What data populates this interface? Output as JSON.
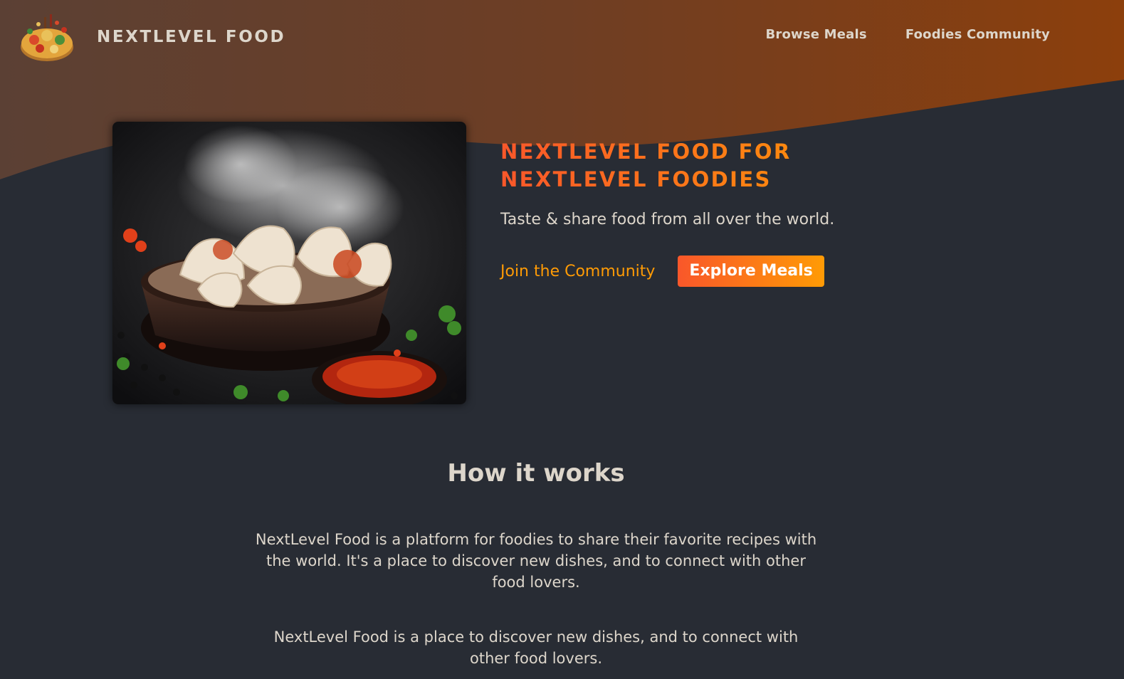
{
  "header": {
    "logo_text": "NEXTLEVEL FOOD",
    "logo_icon": "food-plate-logo"
  },
  "nav": {
    "items": [
      {
        "label": "Browse Meals"
      },
      {
        "label": "Foodies Community"
      }
    ]
  },
  "hero": {
    "image_icon": "dumplings-photo",
    "title": "NEXTLEVEL FOOD FOR NEXTLEVEL FOODIES",
    "subtitle": "Taste & share food from all over the world.",
    "join_link": "Join the Community",
    "explore_button": "Explore Meals"
  },
  "how_it_works": {
    "heading": "How it works",
    "paragraph1": "NextLevel Food is a platform for foodies to share their favorite recipes with the world. It's a place to discover new dishes, and to connect with other food lovers.",
    "paragraph2": "NextLevel Food is a place to discover new dishes, and to connect with other food lovers."
  },
  "colors": {
    "background": "#282c34",
    "header_gradient_start": "#5b4034",
    "header_gradient_end": "#8c3f0c",
    "accent_start": "#f9572a",
    "accent_end": "#ff9b05",
    "text": "#ddd6cb"
  }
}
